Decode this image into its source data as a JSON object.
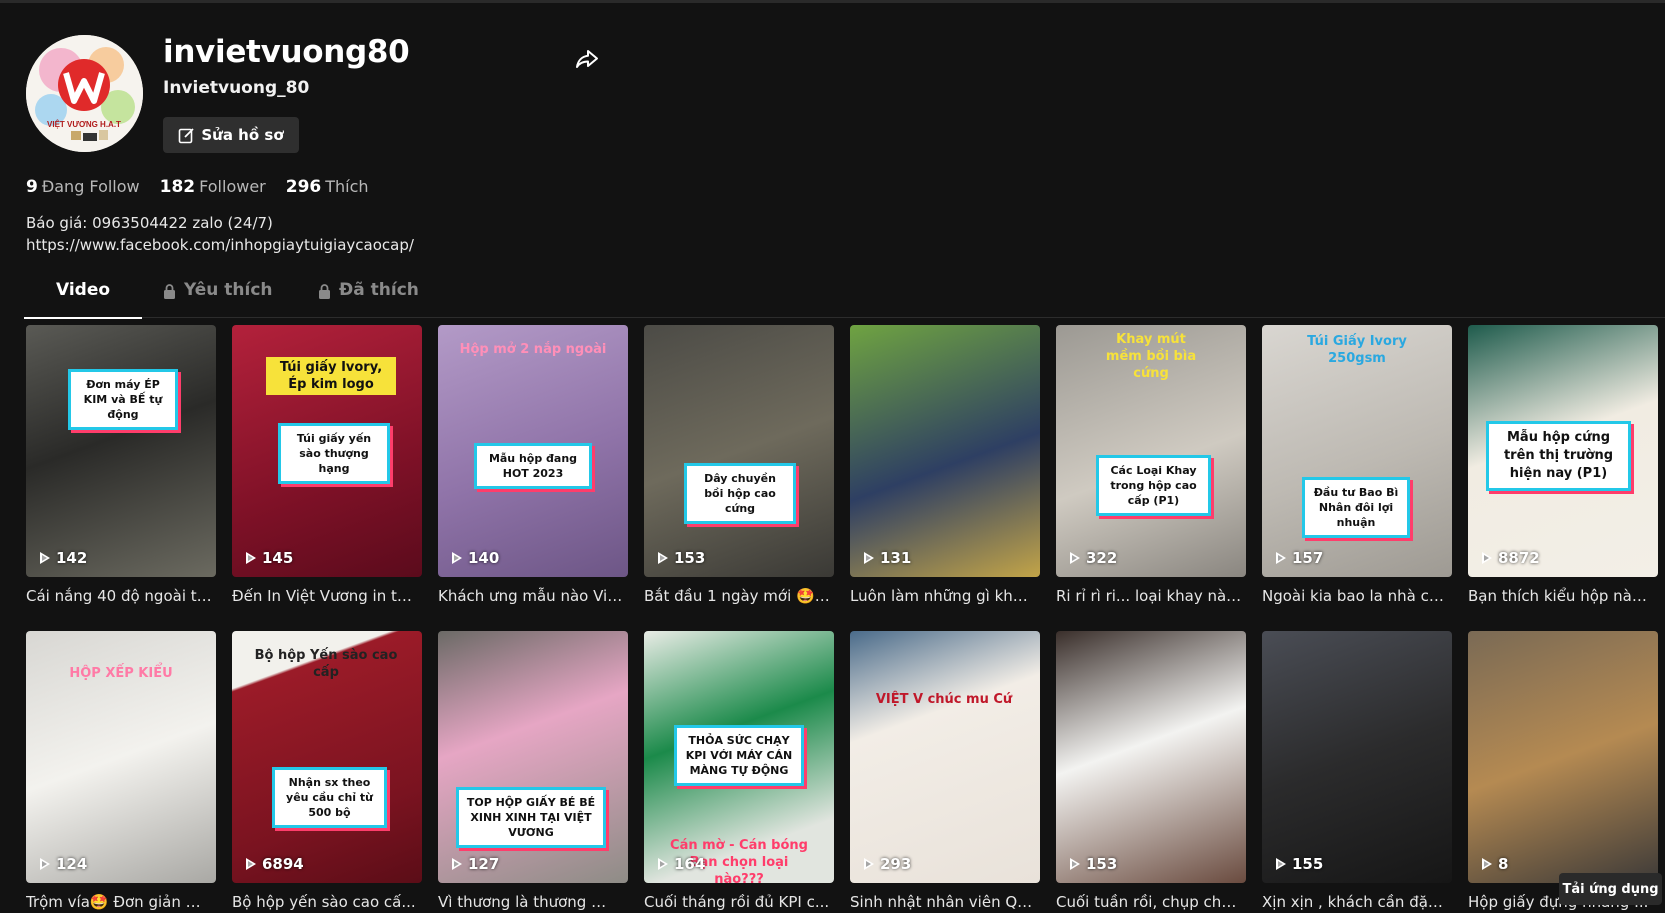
{
  "profile": {
    "username": "invietvuong80",
    "nickname": "Invietvuong_80",
    "edit_label": "Sửa hồ sơ",
    "avatar_text": "VIỆT VƯƠNG H.A.T",
    "stats": [
      {
        "count": "9",
        "label": "Đang Follow"
      },
      {
        "count": "182",
        "label": "Follower"
      },
      {
        "count": "296",
        "label": "Thích"
      }
    ],
    "bio_line1": "Báo giá: 0963504422 zalo (24/7)",
    "bio_line2": "https://www.facebook.com/inhopgiaytuigiaycaocap/"
  },
  "tabs": [
    {
      "label": "Video",
      "active": true
    },
    {
      "label": "Yêu thích",
      "locked": true
    },
    {
      "label": "Đã thích",
      "locked": true
    }
  ],
  "videos": [
    {
      "views": "142",
      "caption": "Cái nắng 40 độ ngoài tr...",
      "overlay": "Đơn máy ÉP KIM và BẾ tự động",
      "bg": "linear-gradient(160deg,#5a5a55,#2a2a28 45%,#6b6a60)"
    },
    {
      "views": "145",
      "caption": "Đến In Việt Vương in tú...",
      "overlay": "Túi giấy yến sào thượng hạng",
      "banner": "Túi giấy Ivory, Ép kim logo",
      "bg": "linear-gradient(160deg,#b3213b,#7f1127 60%,#5b0b1c)"
    },
    {
      "views": "140",
      "caption": "Khách ưng mẫu nào Việ...",
      "overlay": "Mẫu hộp đang HOT 2023",
      "banner": "Hộp mở 2 nắp ngoài",
      "bg": "linear-gradient(160deg,#b39ac7,#8f73a8 55%,#6d5686)"
    },
    {
      "views": "153",
      "caption": "Bắt đầu 1 ngày mới 🤩 ...",
      "overlay": "Dây chuyền bồi hộp cao cứng",
      "bg": "linear-gradient(160deg,#4c4b46,#6e6a5c 50%,#3a3935)"
    },
    {
      "views": "131",
      "caption": "Luôn làm những gì khá...",
      "overlay": "",
      "bg": "linear-gradient(160deg,#6fa341,#2e3f63 55%,#c2a448)"
    },
    {
      "views": "322",
      "caption": "Ri rỉ rì ri... loại khay nào...",
      "overlay": "Các Loại Khay trong hộp cao cấp (P1)",
      "banner": "Khay mút mềm bồi bìa cứng",
      "bg": "linear-gradient(160deg,#9c9993,#cfcac1 55%,#8a8680)"
    },
    {
      "views": "157",
      "caption": "Ngoài kia bao la nhà cu...",
      "overlay": "Đầu tư Bao Bì Nhân đôi lợi nhuận",
      "banner": "Túi Giấy Ivory 250gsm",
      "bg": "linear-gradient(160deg,#d9d6d1,#bdb9b2 55%,#9e9a93)"
    },
    {
      "views": "8872",
      "caption": "Bạn thích kiểu hộp nào ...",
      "overlay": "Mẫu hộp cứng trên thị trường hiện nay (P1)",
      "bg": "linear-gradient(160deg,#1e5b4c,#f1ece2 45%,#f3efe7)"
    },
    {
      "views": "124",
      "caption": "Trộm vía🤩 Đơn giản m...",
      "overlay": "",
      "banner": "HỘP XẾP KIỂU",
      "bg": "linear-gradient(160deg,#d8d7d3,#f3f2ee 50%,#a9a8a4)"
    },
    {
      "views": "6894",
      "caption": "Bộ hộp yến sào cao cấ...",
      "overlay": "Nhận sx theo yêu cầu chỉ từ 500 bộ",
      "banner": "Bộ hộp Yến sào cao cấp",
      "bg": "linear-gradient(160deg,#f2f1ec 0%,#f2f1ec 18%,#9b1b28 19%,#7a1320 70%,#5b0d17)"
    },
    {
      "views": "127",
      "caption": "Vì thương là thương ❤️ ...",
      "overlay": "TOP HỘP GIẤY BÉ BÉ XINH XINH TẠI VIỆT VƯƠNG",
      "bg": "linear-gradient(160deg,#6b6a66,#e6a6c4 40%,#8e8c86)"
    },
    {
      "views": "164",
      "caption": "Cuối tháng rồi đủ KPI c...",
      "overlay": "THỎA SỨC CHẠY KPI VỚI MÁY CÁN MÀNG TỰ ĐỘNG",
      "banner": "Cán mờ - Cán bóng Bạn chọn loại nào???",
      "bg": "linear-gradient(160deg,#e9ece6,#1b8a4a 40%,#e1e5df 80%)"
    },
    {
      "views": "293",
      "caption": "Sinh nhật nhân viên Qu...",
      "overlay": "",
      "banner": "VIỆT V chúc mu Cứ",
      "bg": "linear-gradient(160deg,#4a6b8a,#f2ede6 35%,#e9e2da)"
    },
    {
      "views": "153",
      "caption": "Cuối tuần rồi, chụp chẹ...",
      "overlay": "",
      "bg": "linear-gradient(160deg,#3a2f2b,#f3f3f1 45%,#6a4b3f)"
    },
    {
      "views": "155",
      "caption": "Xịn xịn , khách cần đặt i...",
      "overlay": "",
      "bg": "linear-gradient(160deg,#4a4d55,#2b2b2c 50%,#161616)"
    },
    {
      "views": "8",
      "caption": "Hộp giấy đựng nnang ...",
      "overlay": "",
      "bg": "linear-gradient(160deg,#7a6a55,#b58a52 50%,#3d3a38)"
    }
  ],
  "app_badge": "Tải ứng dụng"
}
